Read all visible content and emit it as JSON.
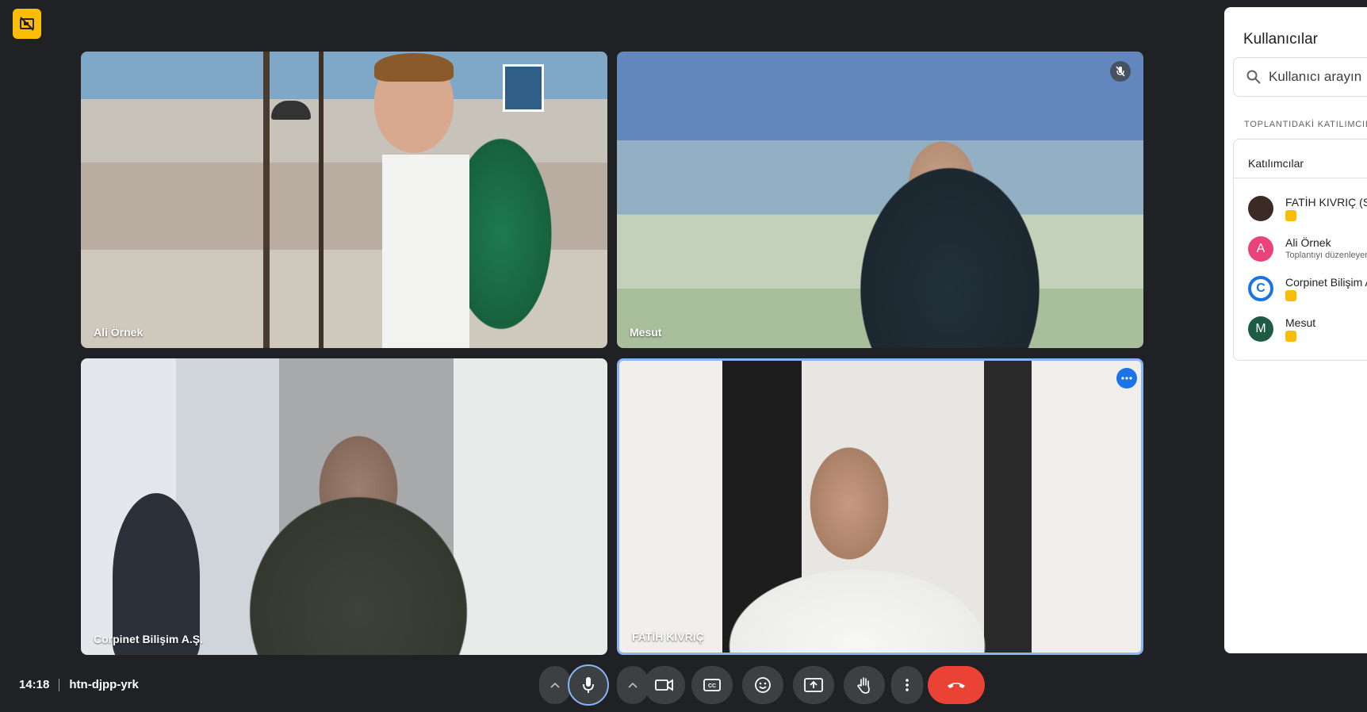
{
  "meeting": {
    "time": "14:18",
    "code": "htn-djpp-yrk"
  },
  "tiles": [
    {
      "name": "Ali Örnek"
    },
    {
      "name": "Mesut"
    },
    {
      "name": "Corpinet Bilişim A.Ş."
    },
    {
      "name": "FATİH KIVRIÇ"
    }
  ],
  "panel": {
    "title": "Kullanıcılar",
    "search_placeholder": "Kullanıcı arayın",
    "section_label": "TOPLANTIDAKİ KATILIMCILAR",
    "group_label": "Katılımcılar",
    "participants": [
      {
        "name": "FATİH KIVRIÇ (Siz)",
        "sub": "",
        "avatar": "",
        "avatar_color": "#3b2b24"
      },
      {
        "name": "Ali Örnek",
        "sub": "Toplantıyı düzenleyen",
        "avatar": "A",
        "avatar_color": "#e8437a"
      },
      {
        "name": "Corpinet Bilişim A.Ş.",
        "sub": "",
        "avatar": "C",
        "avatar_color": "#1a73e8"
      },
      {
        "name": "Mesut",
        "sub": "",
        "avatar": "M",
        "avatar_color": "#1e5b45"
      }
    ]
  },
  "colors": {
    "background": "#202124",
    "recording": "#fbbc04",
    "end_call": "#ea4335",
    "active_speaker": "#8ab4f8"
  },
  "icons": {
    "recording": "recording-icon",
    "muted": "mic-off-icon",
    "more": "more-options-icon",
    "controls": [
      "chevron-up-icon",
      "mic-icon",
      "chevron-up-icon",
      "camera-icon",
      "captions-icon",
      "emoji-icon",
      "present-icon",
      "hand-icon",
      "more-vert-icon",
      "call-end-icon"
    ]
  }
}
